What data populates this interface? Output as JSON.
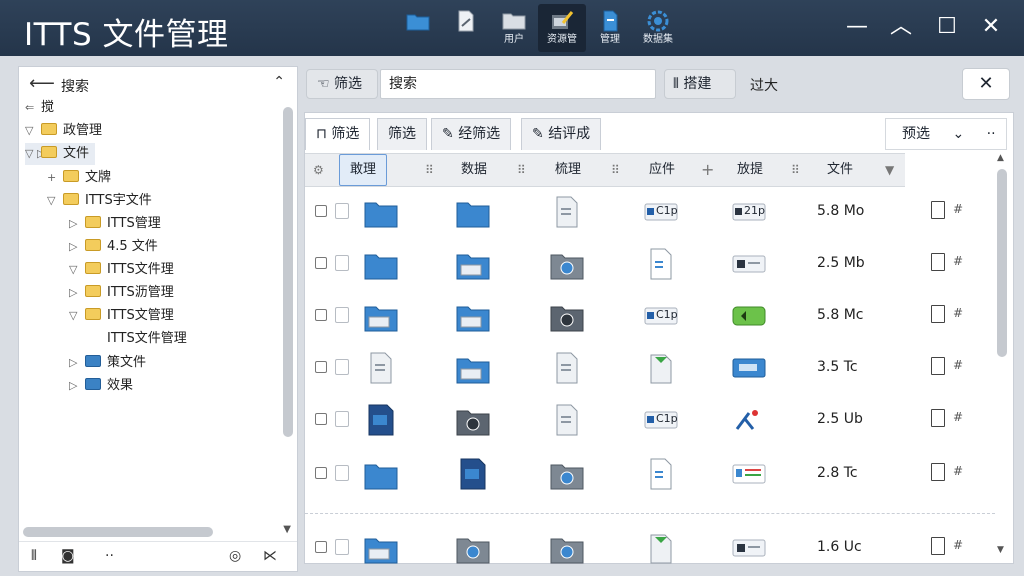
{
  "title": "ITTS 文件管理",
  "toolbar": [
    {
      "label": "",
      "icon": "folder-icon"
    },
    {
      "label": "",
      "icon": "document-edit-icon"
    },
    {
      "label": "用户",
      "icon": "open-folder-icon"
    },
    {
      "label": "资源管",
      "icon": "film-edit-icon"
    },
    {
      "label": "管理",
      "icon": "file-icon"
    },
    {
      "label": "数据集",
      "icon": "gear-icon"
    }
  ],
  "window": {
    "minimize": "—",
    "maximize": "︿",
    "restore": "☐",
    "close": "✕"
  },
  "left_panel": {
    "title": "搜索",
    "back": "⟵",
    "collapse": "⌃",
    "tree": [
      {
        "label": "搅",
        "tog": "⇐",
        "level": 0,
        "folder": false
      },
      {
        "label": "政管理",
        "tog": "▽",
        "level": 0,
        "folder": true
      },
      {
        "label": "文件",
        "tog": "▽ ▷",
        "level": 0,
        "folder": true,
        "selected": true
      },
      {
        "label": "文牌",
        "tog": "+",
        "level": 1,
        "folder": true
      },
      {
        "label": "ITTS宇文件",
        "tog": "▽",
        "level": 1,
        "folder": true
      },
      {
        "label": "ITTS管理",
        "tog": "▷",
        "level": 2,
        "folder": true
      },
      {
        "label": "4.5 文件",
        "tog": "▷",
        "level": 2,
        "folder": true
      },
      {
        "label": "ITTS文件理",
        "tog": "▽",
        "level": 2,
        "folder": true
      },
      {
        "label": "ITTS沥管理",
        "tog": "▷",
        "level": 2,
        "folder": true
      },
      {
        "label": "ITTS文管理",
        "tog": "▽",
        "level": 2,
        "folder": true
      },
      {
        "label": "ITTS文件管理",
        "tog": "",
        "level": 3,
        "folder": false
      },
      {
        "label": "策文件",
        "tog": "▷",
        "level": 2,
        "folder": true,
        "blue": true
      },
      {
        "label": "效果",
        "tog": "▷",
        "level": 2,
        "folder": true,
        "blue": true
      }
    ],
    "footer": [
      "⫴",
      "◙",
      "··",
      "◎",
      "⋉"
    ]
  },
  "search": {
    "filter_label": "筛选",
    "value": "搜索",
    "stats_label": "搭建",
    "zoom_label": "过大",
    "close": "✕"
  },
  "tabs": [
    "筛选",
    "筛选",
    "经筛选",
    "结评成"
  ],
  "preset": {
    "label": "预选",
    "chevron": "⌄",
    "more": "··"
  },
  "columns": [
    "敢理",
    "数据",
    "梳理",
    "应件",
    "放提",
    "文件"
  ],
  "rows": [
    {
      "size": "5.8 Mo",
      "icons": [
        "folder-blue",
        "folder-blue",
        "doc-gray",
        "chip-c1p",
        "chip-21p"
      ],
      "texts": [
        "",
        "",
        "",
        "C1p",
        "21p"
      ]
    },
    {
      "size": "2.5 Mb",
      "icons": [
        "folder-blue",
        "folder-open",
        "folder-gray",
        "doc-white",
        "chip-gray"
      ],
      "texts": [
        "",
        "",
        "",
        "",
        ""
      ]
    },
    {
      "size": "5.8 Mc",
      "icons": [
        "folder-open",
        "folder-open",
        "folder-dark",
        "chip-c1p",
        "chip-green"
      ],
      "texts": [
        "",
        "",
        "",
        "C1p",
        ""
      ]
    },
    {
      "size": "3.5 Tc",
      "icons": [
        "doc-gray",
        "folder-open",
        "doc-gray",
        "doc-green",
        "chip-blue"
      ],
      "texts": [
        "",
        "",
        "",
        "",
        ""
      ]
    },
    {
      "size": "2.5 Ub",
      "icons": [
        "doc-blue",
        "folder-dark",
        "doc-gray",
        "chip-c1p",
        "glyph"
      ],
      "texts": [
        "",
        "",
        "",
        "C1p",
        ""
      ]
    },
    {
      "size": "2.8 Tc",
      "icons": [
        "folder-blue",
        "doc-blue",
        "folder-gray",
        "doc-white",
        "chip-list"
      ],
      "texts": [
        "",
        "",
        "",
        "",
        ""
      ]
    },
    {
      "size": "1.6 Uc",
      "icons": [
        "folder-open",
        "folder-gray",
        "folder-gray",
        "doc-green",
        "chip-gray"
      ],
      "texts": [
        "",
        "",
        "",
        "",
        ""
      ]
    }
  ],
  "row_tail": "#",
  "colors": {
    "titlebar": "#2b3d53",
    "accent": "#3b82c4",
    "folder_yellow": "#f3cc5c"
  }
}
